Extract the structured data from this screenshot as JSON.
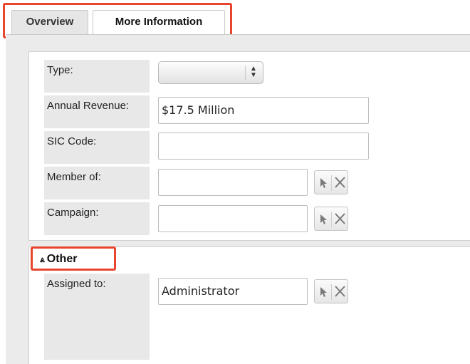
{
  "tabs": [
    {
      "label": "Overview",
      "active": false
    },
    {
      "label": "More Information",
      "active": true
    }
  ],
  "fields": {
    "type": {
      "label": "Type:",
      "value": ""
    },
    "annual_revenue": {
      "label": "Annual Revenue:",
      "value": "$17.5 Million"
    },
    "sic_code": {
      "label": "SIC Code:",
      "value": ""
    },
    "member_of": {
      "label": "Member of:",
      "value": ""
    },
    "campaign": {
      "label": "Campaign:",
      "value": ""
    }
  },
  "other_section": {
    "title": "Other",
    "toggle_icon": "double-chevron-up-icon",
    "assigned_to": {
      "label": "Assigned to:",
      "value": "Administrator"
    }
  },
  "icons": {
    "select": "cursor-arrow-icon",
    "clear": "x-icon"
  },
  "colors": {
    "highlight": "#e8452e",
    "label_bg": "#e8e8e8",
    "content_bg": "#ebebeb"
  }
}
